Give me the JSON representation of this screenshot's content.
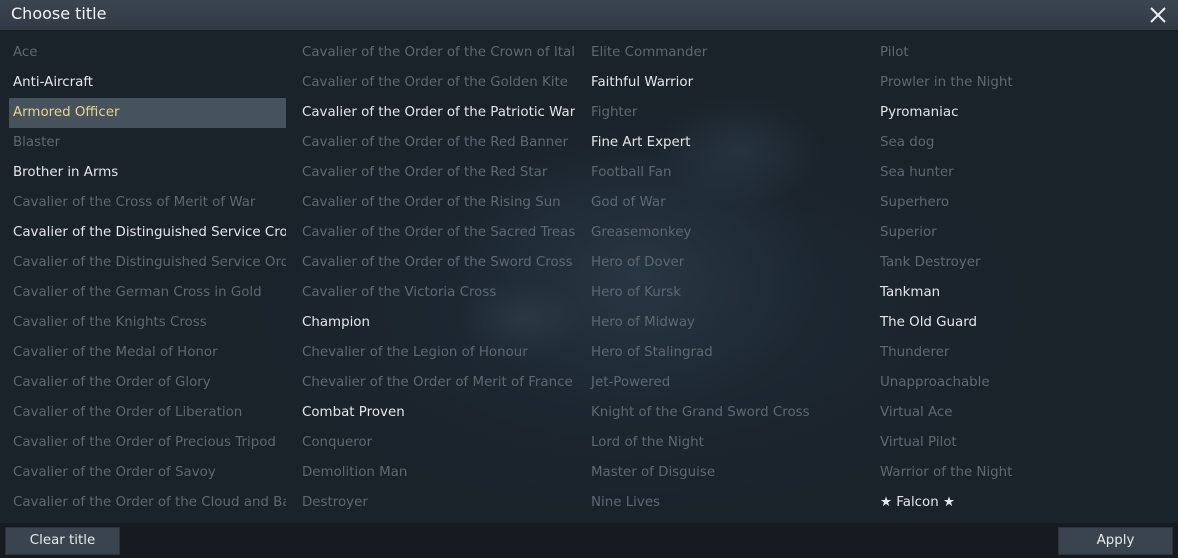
{
  "window": {
    "title": "Choose title"
  },
  "columns": [
    {
      "items": [
        {
          "label": "Ace",
          "state": "locked"
        },
        {
          "label": "Anti-Aircraft",
          "state": "owned"
        },
        {
          "label": "Armored Officer",
          "state": "selected"
        },
        {
          "label": "Blaster",
          "state": "locked"
        },
        {
          "label": "Brother in Arms",
          "state": "owned"
        },
        {
          "label": "Cavalier of the Cross of Merit of War",
          "state": "locked"
        },
        {
          "label": "Cavalier of the Distinguished Service Cross",
          "state": "owned"
        },
        {
          "label": "Cavalier of the Distinguished Service Order",
          "state": "locked"
        },
        {
          "label": "Cavalier of the German Cross in Gold",
          "state": "locked"
        },
        {
          "label": "Cavalier of the Knights Cross",
          "state": "locked"
        },
        {
          "label": "Cavalier of the Medal of Honor",
          "state": "locked"
        },
        {
          "label": "Cavalier of the Order of Glory",
          "state": "locked"
        },
        {
          "label": "Cavalier of the Order of Liberation",
          "state": "locked"
        },
        {
          "label": "Cavalier of the Order of Precious Tripod",
          "state": "locked"
        },
        {
          "label": "Cavalier of the Order of Savoy",
          "state": "locked"
        },
        {
          "label": "Cavalier of the Order of the Cloud and Banner",
          "state": "locked"
        }
      ]
    },
    {
      "items": [
        {
          "label": "Cavalier of the Order of the Crown of Italy",
          "state": "locked"
        },
        {
          "label": "Cavalier of the Order of the Golden Kite",
          "state": "locked"
        },
        {
          "label": "Cavalier of the Order of the Patriotic War",
          "state": "owned"
        },
        {
          "label": "Cavalier of the Order of the Red Banner",
          "state": "locked"
        },
        {
          "label": "Cavalier of the Order of the Red Star",
          "state": "locked"
        },
        {
          "label": "Cavalier of the Order of the Rising Sun",
          "state": "locked"
        },
        {
          "label": "Cavalier of the Order of the Sacred Treasure",
          "state": "locked"
        },
        {
          "label": "Cavalier of the Order of the Sword Cross",
          "state": "locked"
        },
        {
          "label": "Cavalier of the Victoria Cross",
          "state": "locked"
        },
        {
          "label": "Champion",
          "state": "owned"
        },
        {
          "label": "Chevalier of the Legion of Honour",
          "state": "locked"
        },
        {
          "label": "Chevalier of the Order of Merit of France",
          "state": "locked"
        },
        {
          "label": "Combat Proven",
          "state": "owned"
        },
        {
          "label": "Conqueror",
          "state": "locked"
        },
        {
          "label": "Demolition Man",
          "state": "locked"
        },
        {
          "label": "Destroyer",
          "state": "locked"
        }
      ]
    },
    {
      "items": [
        {
          "label": "Elite Commander",
          "state": "locked"
        },
        {
          "label": "Faithful Warrior",
          "state": "owned"
        },
        {
          "label": "Fighter",
          "state": "locked"
        },
        {
          "label": "Fine Art Expert",
          "state": "owned"
        },
        {
          "label": "Football Fan",
          "state": "locked"
        },
        {
          "label": "God of War",
          "state": "locked"
        },
        {
          "label": "Greasemonkey",
          "state": "locked"
        },
        {
          "label": "Hero of Dover",
          "state": "locked"
        },
        {
          "label": "Hero of Kursk",
          "state": "locked"
        },
        {
          "label": "Hero of Midway",
          "state": "locked"
        },
        {
          "label": "Hero of Stalingrad",
          "state": "locked"
        },
        {
          "label": "Jet-Powered",
          "state": "locked"
        },
        {
          "label": "Knight of the Grand Sword Cross",
          "state": "locked"
        },
        {
          "label": "Lord of the Night",
          "state": "locked"
        },
        {
          "label": "Master of Disguise",
          "state": "locked"
        },
        {
          "label": "Nine Lives",
          "state": "locked"
        }
      ]
    },
    {
      "items": [
        {
          "label": "Pilot",
          "state": "locked"
        },
        {
          "label": "Prowler in the Night",
          "state": "locked"
        },
        {
          "label": "Pyromaniac",
          "state": "owned"
        },
        {
          "label": "Sea dog",
          "state": "locked"
        },
        {
          "label": "Sea hunter",
          "state": "locked"
        },
        {
          "label": "Superhero",
          "state": "locked"
        },
        {
          "label": "Superior",
          "state": "locked"
        },
        {
          "label": "Tank Destroyer",
          "state": "locked"
        },
        {
          "label": "Tankman",
          "state": "owned"
        },
        {
          "label": "The Old Guard",
          "state": "owned"
        },
        {
          "label": "Thunderer",
          "state": "locked"
        },
        {
          "label": "Unapproachable",
          "state": "locked"
        },
        {
          "label": "Virtual Ace",
          "state": "locked"
        },
        {
          "label": "Virtual Pilot",
          "state": "locked"
        },
        {
          "label": "Warrior of the Night",
          "state": "locked"
        },
        {
          "label": "★ Falcon ★",
          "state": "owned"
        }
      ]
    }
  ],
  "footer": {
    "clear_label": "Clear title",
    "apply_label": "Apply"
  },
  "colors": {
    "owned": "#e3e7ea",
    "locked": "#5d6871",
    "selected_text": "#e6d58e",
    "selected_bg": "#46525c"
  }
}
